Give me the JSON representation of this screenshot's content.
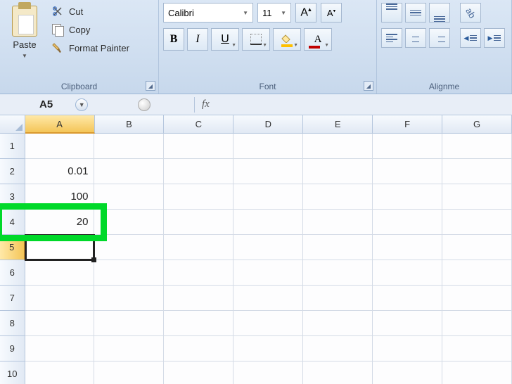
{
  "ribbon": {
    "clipboard": {
      "label": "Clipboard",
      "paste": "Paste",
      "cut": "Cut",
      "copy": "Copy",
      "format_painter": "Format Painter"
    },
    "font": {
      "label": "Font",
      "name": "Calibri",
      "size": "11",
      "bold": "B",
      "italic": "I",
      "underline": "U",
      "grow_a": "A",
      "shrink_a": "A",
      "color_a": "A"
    },
    "alignment": {
      "label": "Alignme"
    }
  },
  "namebox": "A5",
  "fx": "fx",
  "columns": [
    "A",
    "B",
    "C",
    "D",
    "E",
    "F",
    "G"
  ],
  "rows": [
    "1",
    "2",
    "3",
    "4",
    "5",
    "6",
    "7",
    "8",
    "9",
    "10"
  ],
  "cells": {
    "A2": "0.01",
    "A3": "100",
    "A4": "20"
  },
  "selected": "A5",
  "highlighted_row": 4
}
